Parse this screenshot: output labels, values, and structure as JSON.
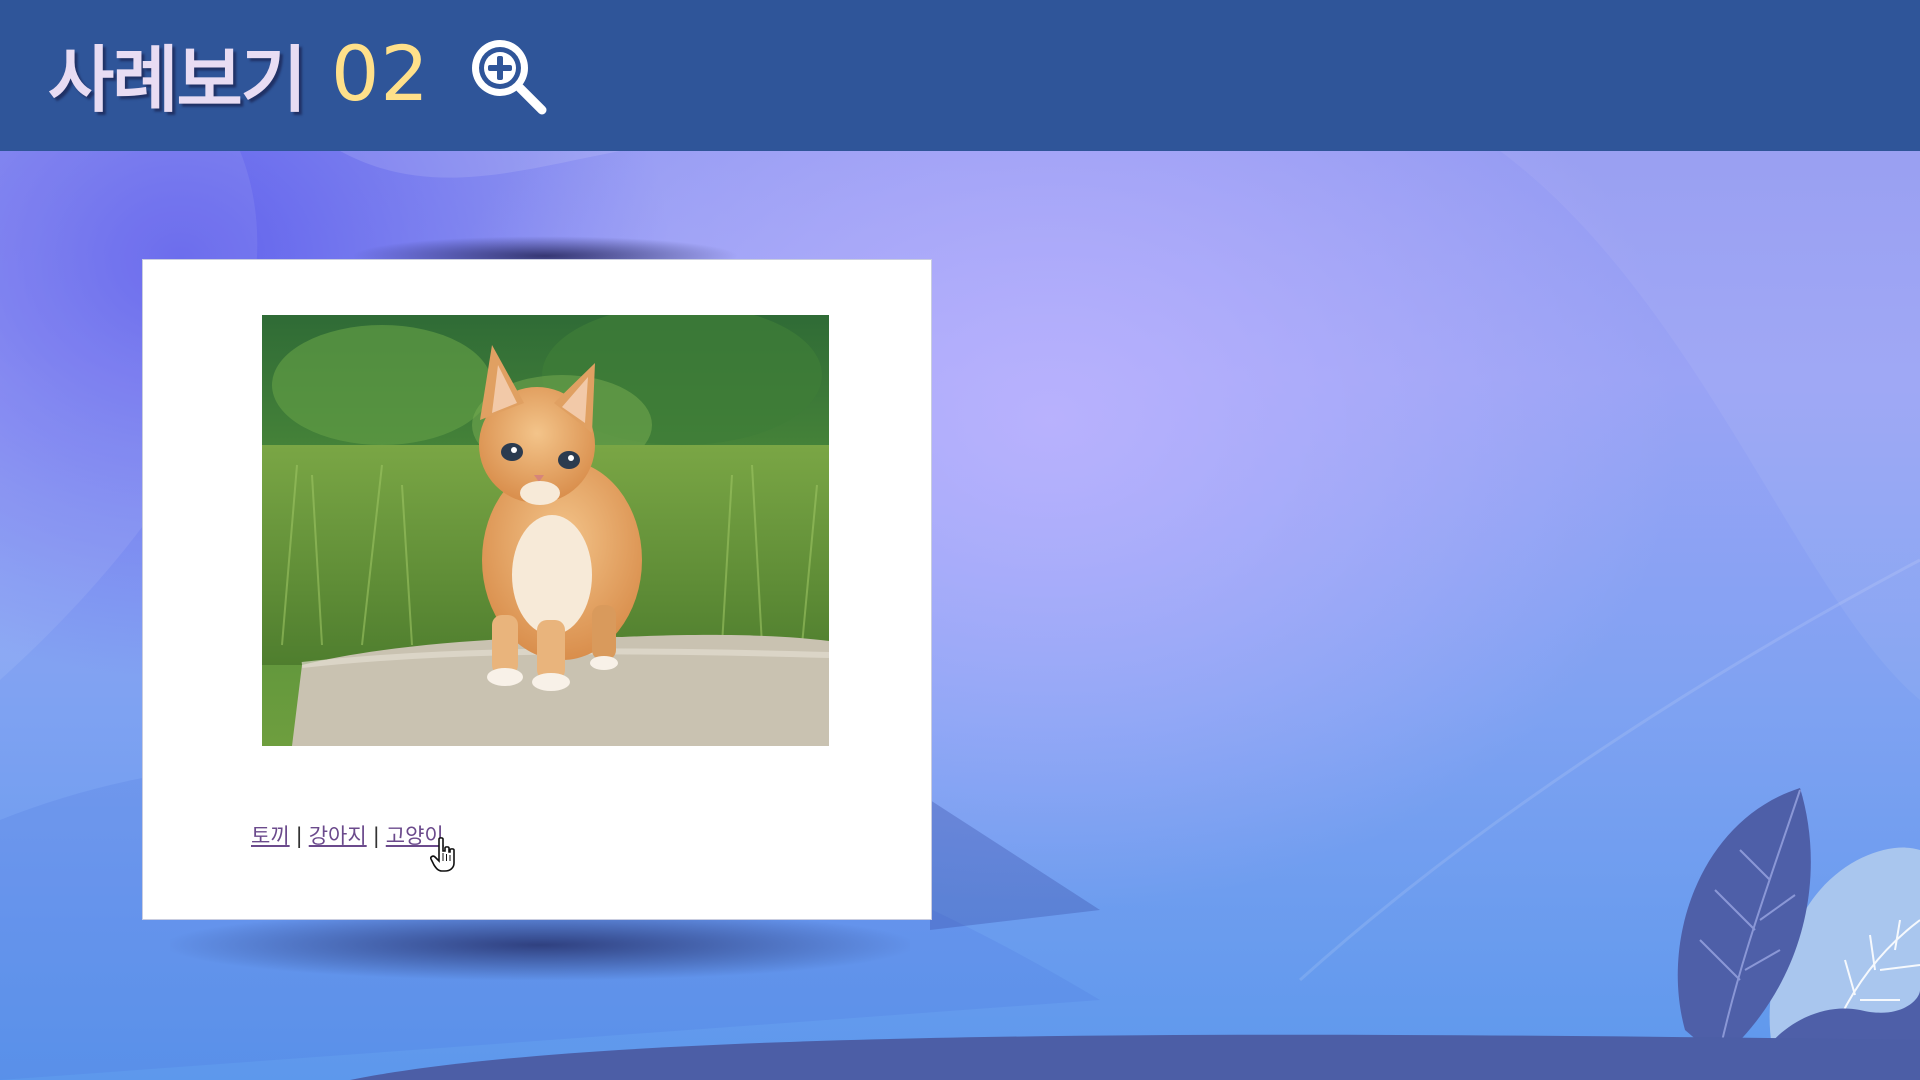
{
  "header": {
    "title": "사례보기",
    "number": "02",
    "zoom_icon": "zoom-in-icon"
  },
  "example": {
    "image_alt": "kitten",
    "links": [
      {
        "label": "토끼"
      },
      {
        "label": "강아지"
      },
      {
        "label": "고양이"
      }
    ],
    "separator": "|"
  },
  "colors": {
    "header_bg": "#2f5599",
    "title_number": "#ffe08a",
    "link": "#6b4a8c"
  }
}
